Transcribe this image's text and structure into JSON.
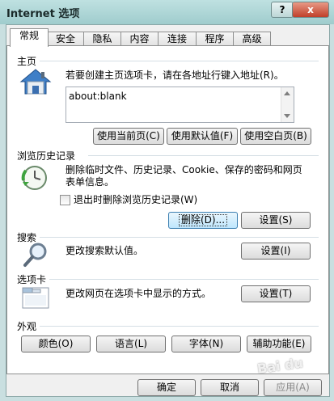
{
  "window": {
    "title": "Internet 选项",
    "help_label": "?",
    "close_label": "x"
  },
  "tabs": [
    {
      "label": "常规",
      "active": true
    },
    {
      "label": "安全"
    },
    {
      "label": "隐私"
    },
    {
      "label": "内容"
    },
    {
      "label": "连接"
    },
    {
      "label": "程序"
    },
    {
      "label": "高级"
    }
  ],
  "home": {
    "title": "主页",
    "description": "若要创建主页选项卡，请在各地址行键入地址(R)。",
    "address_value": "about:blank",
    "btn_current": "使用当前页(C)",
    "btn_default": "使用默认值(F)",
    "btn_blank": "使用空白页(B)"
  },
  "history": {
    "title": "浏览历史记录",
    "description_line1": "删除临时文件、历史记录、Cookie、保存的密码和网页",
    "description_line2": "表单信息。",
    "checkbox_label": "退出时删除浏览历史记录(W)",
    "checkbox_checked": false,
    "btn_delete": "删除(D)...",
    "btn_settings": "设置(S)"
  },
  "search": {
    "title": "搜索",
    "description": "更改搜索默认值。",
    "btn_settings": "设置(I)"
  },
  "tabs_group": {
    "title": "选项卡",
    "description": "更改网页在选项卡中显示的方式。",
    "btn_settings": "设置(T)"
  },
  "appearance": {
    "title": "外观",
    "btn_colors": "颜色(O)",
    "btn_languages": "语言(L)",
    "btn_fonts": "字体(N)",
    "btn_accessibility": "辅助功能(E)"
  },
  "footer": {
    "ok": "确定",
    "cancel": "取消",
    "apply": "应用(A)",
    "watermark": "Bai du"
  }
}
